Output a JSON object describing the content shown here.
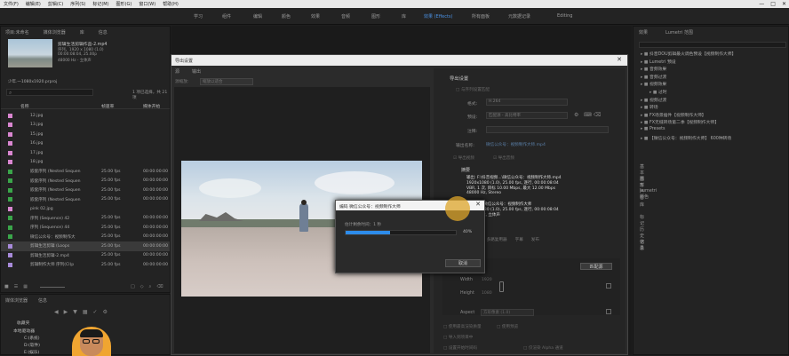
{
  "menubar": {
    "items": [
      "文件(F)",
      "编辑(E)",
      "剪辑(C)",
      "序列(S)",
      "标记(M)",
      "图形(G)",
      "窗口(W)",
      "帮助(H)"
    ]
  },
  "workspaces": [
    "学习",
    "组件",
    "编辑",
    "颜色",
    "效果",
    "音频",
    "图形",
    "库",
    "效果 (Effects)",
    "所有面板",
    "元数据记录",
    "Editing"
  ],
  "project": {
    "tabs": [
      "项目:未命名",
      "媒体浏览器",
      "库",
      "信息",
      "效果",
      "标记"
    ],
    "clip_title": "剪辑生活剪辑作品-2.mp4",
    "clip_info1": "序列，1920 x 1080 (1.0)",
    "clip_info2": "00:00:08:04, 25.00p",
    "clip_info3": "48000 Hz - 立体声",
    "bin_path": "少年.一1080x1920.prproj",
    "search_placeholder": "",
    "filter_label": "1 项已选择，共 21 项",
    "col_name": "名称",
    "col_fps": "帧速率",
    "col_start": "媒体开始",
    "rows": [
      {
        "name": "12.jpg",
        "fps": "",
        "start": "",
        "color": "#d986d0"
      },
      {
        "name": "13.jpg",
        "fps": "",
        "start": "",
        "color": "#d986d0"
      },
      {
        "name": "15.jpg",
        "fps": "",
        "start": "",
        "color": "#d986d0"
      },
      {
        "name": "16.jpg",
        "fps": "",
        "start": "",
        "color": "#d986d0"
      },
      {
        "name": "17.jpg",
        "fps": "",
        "start": "",
        "color": "#d986d0"
      },
      {
        "name": "18.jpg",
        "fps": "",
        "start": "",
        "color": "#d986d0"
      },
      {
        "name": "嵌套序列 (Nested Sequen",
        "fps": "25.00 fps",
        "start": "00:00:00:00",
        "color": "#3aa54a"
      },
      {
        "name": "嵌套序列 (Nested Sequen",
        "fps": "25.00 fps",
        "start": "00:00:00:00",
        "color": "#3aa54a"
      },
      {
        "name": "嵌套序列 (Nested Sequen",
        "fps": "25.00 fps",
        "start": "00:00:00:00",
        "color": "#3aa54a"
      },
      {
        "name": "嵌套序列 (Nested Sequen",
        "fps": "25.00 fps",
        "start": "00:00:00:00",
        "color": "#3aa54a"
      },
      {
        "name": "pink 02.jpg",
        "fps": "",
        "start": "",
        "color": "#d986d0"
      },
      {
        "name": "序列 (Sequence) 42",
        "fps": "25.00 fps",
        "start": "00:00:00:00",
        "color": "#3aa54a"
      },
      {
        "name": "序列 (Sequence) 44",
        "fps": "25.00 fps",
        "start": "00:00:00:00",
        "color": "#3aa54a"
      },
      {
        "name": "微信公众号：视频制作大",
        "fps": "25.00 fps",
        "start": "00:00:00:00",
        "color": "#3aa54a"
      },
      {
        "name": "剪辑生活剪辑 (Loops",
        "fps": "25.00 fps",
        "start": "00:00:00:00",
        "color": "#a78ad9"
      },
      {
        "name": "剪辑生活剪辑-2.mp4",
        "fps": "25.00 fps",
        "start": "00:00:00:00",
        "color": "#a78ad9"
      },
      {
        "name": "剪辑制作大师 序列(Cl)p",
        "fps": "25.00 fps",
        "start": "00:00:00:00",
        "color": "#a78ad9"
      }
    ]
  },
  "media_browser": {
    "tabs": [
      "媒体浏览器",
      "信息"
    ],
    "tree_root": "收藏夹",
    "drive_label": "本地驱动器",
    "drives": [
      "C:(系统)",
      "D:(软件)",
      "E:(娱乐)"
    ]
  },
  "export_dialog": {
    "title": "导出设置",
    "tabs": [
      "源",
      "输出"
    ],
    "source_scaling_label": "源缩放:",
    "source_scaling_value": "缩放以适合",
    "export_settings_heading": "导出设置",
    "match_sequence": "与序列设置匹配",
    "format_label": "格式:",
    "format_value": "H.264",
    "preset_label": "预设:",
    "preset_value": "匹配源 - 高比特率",
    "comments_label": "注释:",
    "output_name_label": "输出名称:",
    "output_name_value": "微信公众号：视频制作大师.mp4",
    "export_video": "导出视频",
    "export_audio": "导出音频",
    "summary_heading": "摘要",
    "summary_output_label": "输出:",
    "summary_output_text": "F:\\抖音视频...\\微信公众号：视频制作大师.mp4",
    "summary_line2": "1920x1080 (1.0), 25.00 fps, 逐行, 00:00:08:04",
    "summary_line3": "VBR, 1 次, 目标 10.00 Mbps, 最大 12.00 Mbps",
    "summary_line4": "48000 Hz, Stereo",
    "summary_source_label": "源:",
    "summary_source_text": "序列, 微信公众号：视频制作大师",
    "summary_source_line2": "1920x1080 (1.0), 25.00 fps, 逐行, 00:00:08:04",
    "summary_source_line3": "48000 Hz, 立体声",
    "tabs2": [
      "效果",
      "视频",
      "音频",
      "多路复用器",
      "字幕",
      "发布"
    ],
    "width_label": "Width",
    "height_label": "Height",
    "width_value": "1920",
    "height_value": "1080",
    "aspect_label": "Aspect",
    "aspect_value": "方形像素 (1.0)",
    "match_source_button": "匹配源",
    "use_max_quality": "使用最高渲染质量",
    "use_previews": "使用预览",
    "import_into_project": "导入到项目中",
    "set_start_timecode": "设置开始时间码",
    "render_alpha": "仅渲染 Alpha 通道"
  },
  "encoding_dialog": {
    "title": "编码 微信公众号：视频制作大师",
    "status_label": "估计剩余时间：1 秒",
    "progress_percent": 40,
    "progress_text": "40%",
    "cancel_button": "取消"
  },
  "right_panel": {
    "tabs": [
      "效果",
      "Lumetri 范围"
    ],
    "items": [
      "抖音DOU剪辑最火调色预设【视频制作大师】",
      "Lumetri 预设",
      "音频效果",
      "音频过渡",
      "视频效果",
      "过时",
      "视频过渡",
      "转场",
      "FX场景插件【视频制作大师】",
      "FX无缝转场第二季【视频制作大师】",
      "Presets",
      "【微信公众号：视频制作大师】 600种转场"
    ],
    "sections": [
      "基本图形",
      "基本声音",
      "Lumetri 颜色",
      "库",
      "标记",
      "历史记录",
      "信息"
    ]
  },
  "colors": {
    "accent": "#2d8ceb",
    "progress": "#2d8ceb",
    "clip_pink": "#d986d0",
    "clip_green": "#3aa54a",
    "clip_purple": "#a78ad9"
  }
}
